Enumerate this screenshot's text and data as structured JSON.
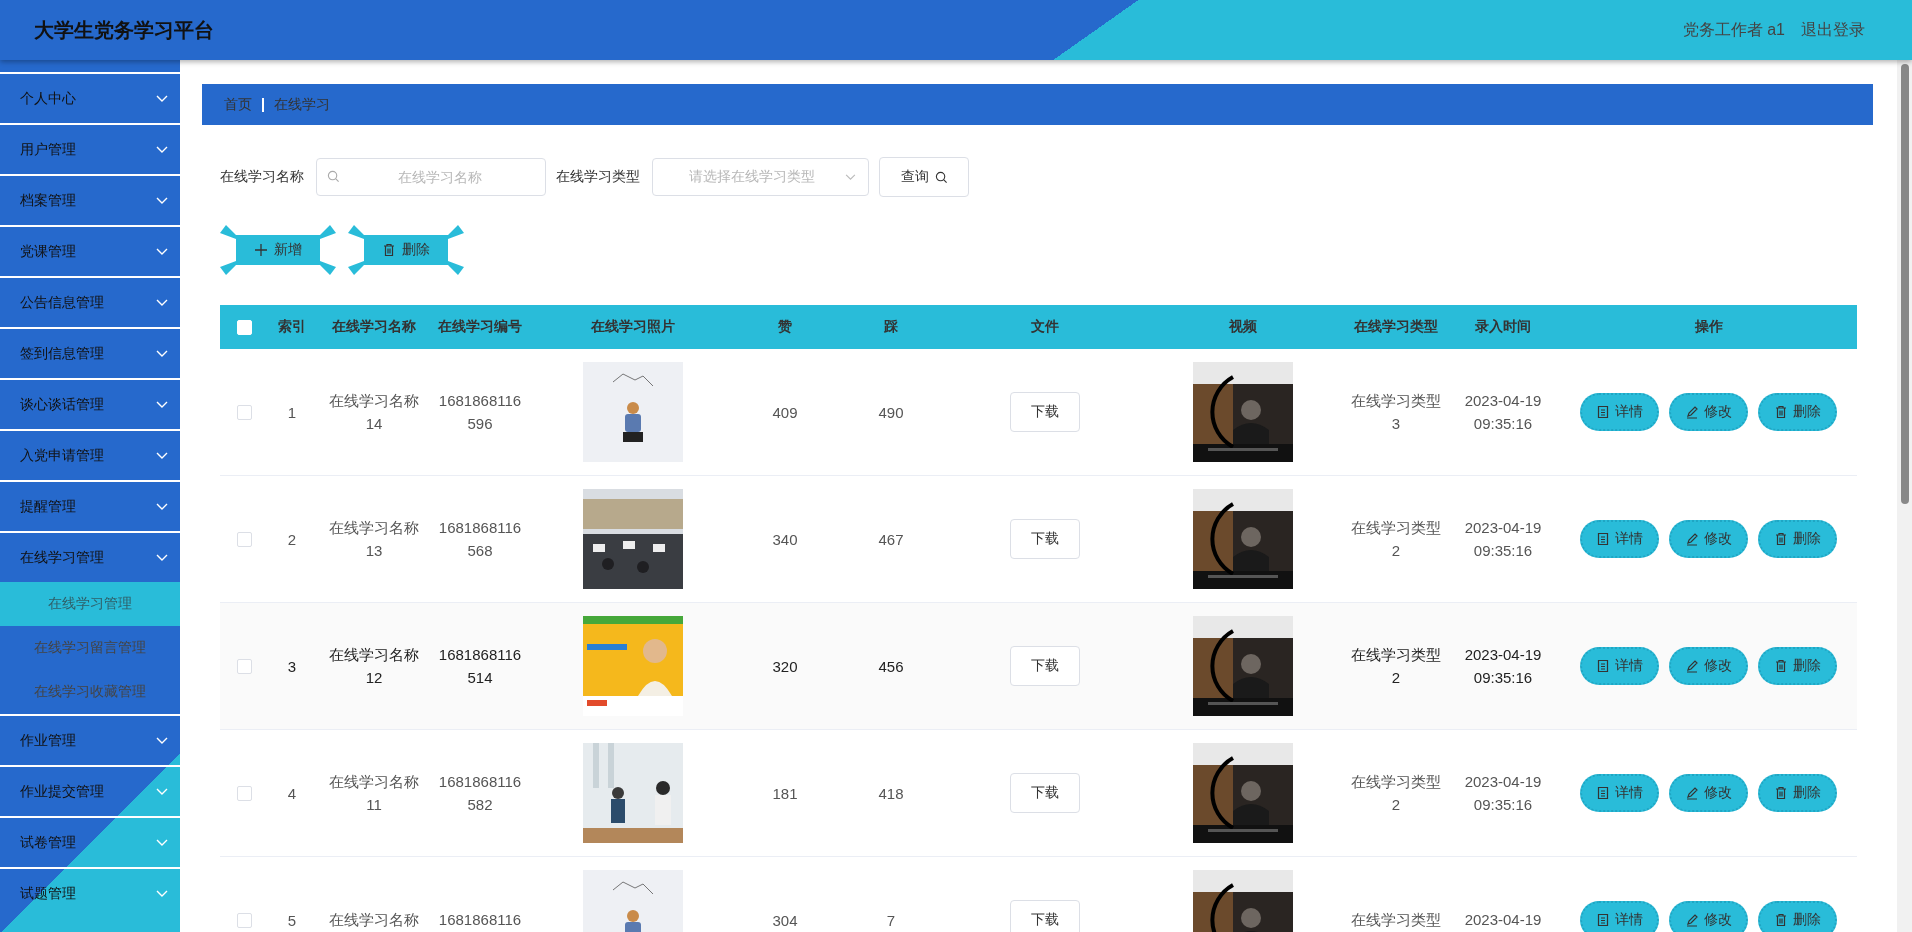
{
  "header": {
    "title": "大学生党务学习平台",
    "user": "党务工作者 a1",
    "logout": "退出登录"
  },
  "sidebar": {
    "items": [
      {
        "label": "个人中心"
      },
      {
        "label": "用户管理"
      },
      {
        "label": "档案管理"
      },
      {
        "label": "党课管理"
      },
      {
        "label": "公告信息管理"
      },
      {
        "label": "签到信息管理"
      },
      {
        "label": "谈心谈话管理"
      },
      {
        "label": "入党申请管理"
      },
      {
        "label": "提醒管理"
      },
      {
        "label": "在线学习管理",
        "children": [
          {
            "label": "在线学习管理",
            "selected": true
          },
          {
            "label": "在线学习留言管理",
            "selected": false
          },
          {
            "label": "在线学习收藏管理",
            "selected": false
          }
        ]
      },
      {
        "label": "作业管理"
      },
      {
        "label": "作业提交管理"
      },
      {
        "label": "试卷管理"
      },
      {
        "label": "试题管理"
      }
    ]
  },
  "breadcrumb": [
    "首页",
    "在线学习"
  ],
  "search": {
    "fields": [
      {
        "kind": "text",
        "label": "在线学习名称",
        "placeholder": "在线学习名称"
      },
      {
        "kind": "select",
        "label": "在线学习类型",
        "placeholder": "请选择在线学习类型"
      }
    ],
    "button": "查询"
  },
  "toolbar": [
    {
      "kind": "add",
      "label": "新增"
    },
    {
      "kind": "delete",
      "label": "删除"
    }
  ],
  "table": {
    "all_checked": false,
    "columns": [
      "索引",
      "在线学习名称",
      "在线学习编号",
      "在线学习照片",
      "赞",
      "踩",
      "文件",
      "视频",
      "在线学习类型",
      "录入时间",
      "操作"
    ],
    "rows": [
      {
        "checked": false,
        "highlighted": false,
        "index": "1",
        "name": "在线学习名称\n14",
        "number": "1681868116\n596",
        "likes": "409",
        "dislikes": "490",
        "file": "下载",
        "type": "在线学习类型\n3",
        "time": "2023-04-19\n09:35:16",
        "actions": [
          {
            "kind": "detail",
            "label": "详情"
          },
          {
            "kind": "edit",
            "label": "修改"
          },
          {
            "kind": "delete",
            "label": "删除"
          }
        ]
      },
      {
        "checked": false,
        "highlighted": false,
        "index": "2",
        "name": "在线学习名称\n13",
        "number": "1681868116\n568",
        "likes": "340",
        "dislikes": "467",
        "file": "下载",
        "type": "在线学习类型\n2",
        "time": "2023-04-19\n09:35:16",
        "actions": [
          {
            "kind": "detail",
            "label": "详情"
          },
          {
            "kind": "edit",
            "label": "修改"
          },
          {
            "kind": "delete",
            "label": "删除"
          }
        ]
      },
      {
        "checked": false,
        "highlighted": true,
        "index": "3",
        "name": "在线学习名称\n12",
        "number": "1681868116\n514",
        "likes": "320",
        "dislikes": "456",
        "file": "下载",
        "type": "在线学习类型\n2",
        "time": "2023-04-19\n09:35:16",
        "actions": [
          {
            "kind": "detail",
            "label": "详情"
          },
          {
            "kind": "edit",
            "label": "修改"
          },
          {
            "kind": "delete",
            "label": "删除"
          }
        ]
      },
      {
        "checked": false,
        "highlighted": false,
        "index": "4",
        "name": "在线学习名称\n11",
        "number": "1681868116\n582",
        "likes": "181",
        "dislikes": "418",
        "file": "下载",
        "type": "在线学习类型\n2",
        "time": "2023-04-19\n09:35:16",
        "actions": [
          {
            "kind": "detail",
            "label": "详情"
          },
          {
            "kind": "edit",
            "label": "修改"
          },
          {
            "kind": "delete",
            "label": "删除"
          }
        ]
      },
      {
        "checked": false,
        "highlighted": false,
        "index": "5",
        "name": "在线学习名称",
        "number": "1681868116",
        "likes": "304",
        "dislikes": "7",
        "file": "下载",
        "type": "在线学习类型",
        "time": "2023-04-19",
        "actions": [
          {
            "kind": "detail",
            "label": "详情"
          },
          {
            "kind": "edit",
            "label": "修改"
          },
          {
            "kind": "delete",
            "label": "删除"
          }
        ]
      }
    ]
  }
}
